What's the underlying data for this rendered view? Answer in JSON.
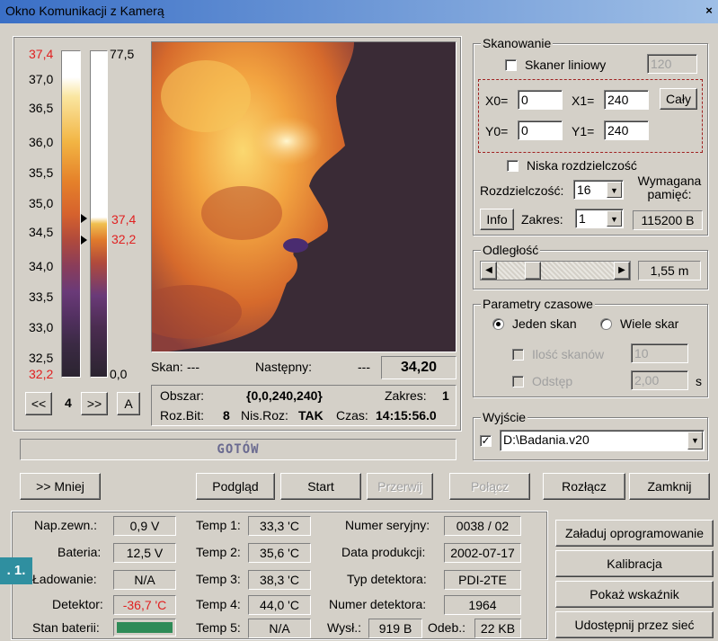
{
  "window": {
    "title": "Okno Komunikacji z Kamerą",
    "close_glyph": "×"
  },
  "scale": {
    "top_left": "37,4",
    "top_right": "77,5",
    "ticks": [
      "37,0",
      "36,5",
      "36,0",
      "35,5",
      "35,0",
      "34,5",
      "34,0",
      "33,5",
      "33,0",
      "32,5"
    ],
    "bottom_left": "32,2",
    "bottom_right": "0,0",
    "marker_upper": "37,4",
    "marker_lower": "32,2"
  },
  "nav": {
    "prev": "<<",
    "value": "4",
    "next": ">>",
    "auto": "A"
  },
  "readout": {
    "skan_label": "Skan:",
    "skan_value": "---",
    "next_label": "Następny:",
    "next_value": "---",
    "big_value": "34,20",
    "obszar_label": "Obszar:",
    "obszar_value": "{0,0,240,240}",
    "zakres_label": "Zakres:",
    "zakres_value": "1",
    "rozbit_label": "Roz.Bit:",
    "rozbit_value": "8",
    "nisroz_label": "Nis.Roz:",
    "nisroz_value": "TAK",
    "czas_label": "Czas:",
    "czas_value": "14:15:56.0"
  },
  "status": {
    "text": "GOTÓW"
  },
  "scanning": {
    "legend": "Skanowanie",
    "line_scanner_label": "Skaner liniowy",
    "line_scanner_value": "120",
    "x0_label": "X0=",
    "x0": "0",
    "x1_label": "X1=",
    "x1": "240",
    "y0_label": "Y0=",
    "y0": "0",
    "y1_label": "Y1=",
    "y1": "240",
    "full_button": "Cały",
    "low_res_label": "Niska rozdzielczość",
    "resolution_label": "Rozdzielczość:",
    "resolution_value": "16",
    "required_memory_label": "Wymagana pamięć:",
    "info_button": "Info",
    "range_label": "Zakres:",
    "range_value": "1",
    "memory_value": "115200 B"
  },
  "distance": {
    "legend": "Odległość",
    "value": "1,55 m",
    "slider_fraction": 0.28
  },
  "timing": {
    "legend": "Parametry czasowe",
    "single_scan": "Jeden skan",
    "multi_scan": "Wiele skar",
    "scan_count_label": "Ilość skanów",
    "scan_count_value": "10",
    "interval_label": "Odstęp",
    "interval_value": "2,00",
    "interval_unit": "s"
  },
  "output": {
    "legend": "Wyjście",
    "path": "D:\\Badania.v20"
  },
  "buttons": {
    "less": ">> Mniej",
    "preview": "Podgląd",
    "start": "Start",
    "interrupt": "Przerwij",
    "connect": "Połącz",
    "disconnect": "Rozłącz",
    "close": "Zamknij"
  },
  "info": {
    "ext_voltage_label": "Nap.zewn.:",
    "ext_voltage": "0,9 V",
    "battery_label": "Bateria:",
    "battery": "12,5 V",
    "charging_label": "Ładowanie:",
    "charging": "N/A",
    "detector_label": "Detektor:",
    "detector": "-36,7 'C",
    "battery_state_label": "Stan baterii:",
    "temp1_label": "Temp 1:",
    "temp1": "33,3 'C",
    "temp2_label": "Temp 2:",
    "temp2": "35,6 'C",
    "temp3_label": "Temp 3:",
    "temp3": "38,3 'C",
    "temp4_label": "Temp 4:",
    "temp4": "44,0 'C",
    "temp5_label": "Temp 5:",
    "temp5": "N/A",
    "serial_label": "Numer seryjny:",
    "serial": "0038 / 02",
    "prod_date_label": "Data produkcji:",
    "prod_date": "2002-07-17",
    "detector_type_label": "Typ detektora:",
    "detector_type": "PDI-2TE",
    "detector_no_label": "Numer detektora:",
    "detector_no": "1964",
    "sent_label": "Wysł.:",
    "sent": "919 B",
    "recv_label": "Odeb.:",
    "recv": "22 KB"
  },
  "side_buttons": {
    "firmware": "Załaduj oprogramowanie",
    "calibration": "Kalibracja",
    "indicator": "Pokaż wskaźnik",
    "share": "Udostępnij przez sieć"
  },
  "figure_tag": ". 1.",
  "colors": {
    "title_start": "#3a6fc6",
    "status_text": "#6a6a90",
    "red_value": "#e02020",
    "battery_green": "#2e8b57"
  }
}
